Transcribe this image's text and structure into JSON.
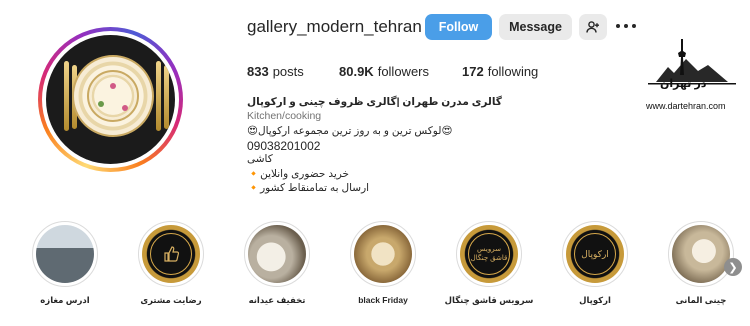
{
  "profile": {
    "username": "gallery_modern_tehran",
    "follow_label": "Follow",
    "message_label": "Message",
    "stats": {
      "posts_count": "833",
      "posts_label": "posts",
      "followers_count": "80.9K",
      "followers_label": "followers",
      "following_count": "172",
      "following_label": "following"
    },
    "bio": {
      "name": "گالری مدرن طهران |گالری ظروف چینی و ارکوپال",
      "category": "Kitchen/cooking",
      "line1": "😍لوکس ترین و به روز ترین مجموعه ارکوپال😍",
      "phone": "09038201002",
      "line2": "کاشی",
      "line3": "🔸خرید حضوری وانلاین",
      "line4": "🔸ارسال به تمامنقاط کشور"
    }
  },
  "watermark": {
    "title": "در تهران",
    "url": "www.dartehran.com"
  },
  "highlights": [
    {
      "label": "ادرس مغازه",
      "icon": "shop-photo"
    },
    {
      "label": "رضایت مشتری",
      "icon": "thumbs-up-icon"
    },
    {
      "label": "تخفیف عیدانه",
      "icon": "tableware-photo"
    },
    {
      "label": "black Friday",
      "icon": "plates-photo"
    },
    {
      "label": "سرویس قاشق چنگال",
      "icon": "cutlery-badge",
      "badge_text": "سرویس قاشق چنگال"
    },
    {
      "label": "ارکوپال",
      "icon": "arcopal-badge",
      "badge_text": "ارکوپال"
    },
    {
      "label": "چینی المانی",
      "icon": "china-photo"
    }
  ]
}
